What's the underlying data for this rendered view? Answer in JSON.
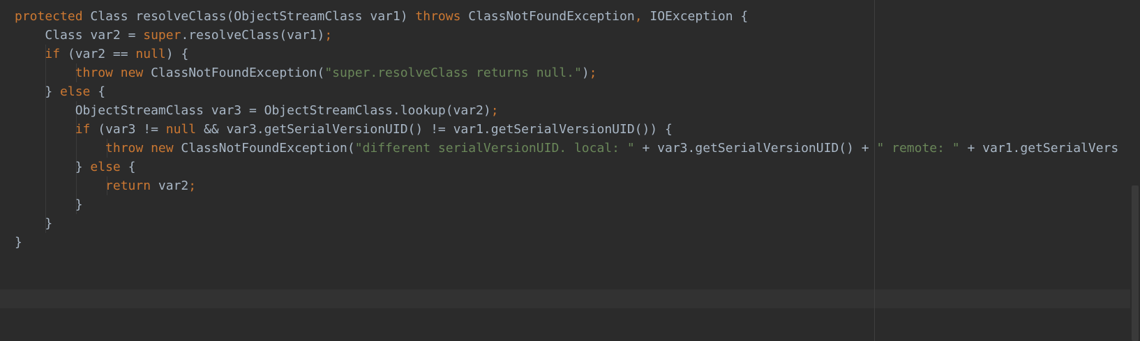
{
  "colors": {
    "background": "#2b2b2b",
    "keyword": "#cc7832",
    "identifier": "#a9b7c6",
    "string": "#6a8759",
    "punctuation": "#cc7832",
    "caret_line": "#323232"
  },
  "code": {
    "lines": [
      {
        "indent": 0,
        "tokens": [
          {
            "t": "kw",
            "v": "protected"
          },
          {
            "t": "ws",
            "v": " "
          },
          {
            "t": "id",
            "v": "Class resolveClass(ObjectStreamClass var1) "
          },
          {
            "t": "kw",
            "v": "throws"
          },
          {
            "t": "ws",
            "v": " "
          },
          {
            "t": "id",
            "v": "ClassNotFoundException"
          },
          {
            "t": "pn",
            "v": ","
          },
          {
            "t": "id",
            "v": " IOException {"
          }
        ]
      },
      {
        "indent": 1,
        "tokens": [
          {
            "t": "id",
            "v": "Class var2 = "
          },
          {
            "t": "kw",
            "v": "super"
          },
          {
            "t": "id",
            "v": ".resolveClass(var1)"
          },
          {
            "t": "pn",
            "v": ";"
          }
        ]
      },
      {
        "indent": 1,
        "tokens": [
          {
            "t": "kw",
            "v": "if"
          },
          {
            "t": "id",
            "v": " (var2 == "
          },
          {
            "t": "kw",
            "v": "null"
          },
          {
            "t": "id",
            "v": ") {"
          }
        ]
      },
      {
        "indent": 2,
        "tokens": [
          {
            "t": "kw",
            "v": "throw"
          },
          {
            "t": "ws",
            "v": " "
          },
          {
            "t": "kw",
            "v": "new"
          },
          {
            "t": "id",
            "v": " ClassNotFoundException("
          },
          {
            "t": "str",
            "v": "\"super.resolveClass returns null.\""
          },
          {
            "t": "id",
            "v": ")"
          },
          {
            "t": "pn",
            "v": ";"
          }
        ]
      },
      {
        "indent": 1,
        "tokens": [
          {
            "t": "id",
            "v": "} "
          },
          {
            "t": "kw",
            "v": "else"
          },
          {
            "t": "id",
            "v": " {"
          }
        ]
      },
      {
        "indent": 2,
        "tokens": [
          {
            "t": "id",
            "v": "ObjectStreamClass var3 = ObjectStreamClass.lookup(var2)"
          },
          {
            "t": "pn",
            "v": ";"
          }
        ]
      },
      {
        "indent": 2,
        "tokens": [
          {
            "t": "kw",
            "v": "if"
          },
          {
            "t": "id",
            "v": " (var3 != "
          },
          {
            "t": "kw",
            "v": "null"
          },
          {
            "t": "id",
            "v": " && var3.getSerialVersionUID() != var1.getSerialVersionUID()) {"
          }
        ]
      },
      {
        "indent": 3,
        "tokens": [
          {
            "t": "kw",
            "v": "throw"
          },
          {
            "t": "ws",
            "v": " "
          },
          {
            "t": "kw",
            "v": "new"
          },
          {
            "t": "id",
            "v": " ClassNotFoundException("
          },
          {
            "t": "str",
            "v": "\"different serialVersionUID. local: \""
          },
          {
            "t": "id",
            "v": " + var3.getSerialVersionUID() + "
          },
          {
            "t": "str",
            "v": "\" remote: \""
          },
          {
            "t": "id",
            "v": " + var1.getSerialVers"
          }
        ]
      },
      {
        "indent": 2,
        "tokens": [
          {
            "t": "id",
            "v": "} "
          },
          {
            "t": "kw",
            "v": "else"
          },
          {
            "t": "id",
            "v": " {"
          }
        ]
      },
      {
        "indent": 3,
        "tokens": [
          {
            "t": "kw",
            "v": "return"
          },
          {
            "t": "id",
            "v": " var2"
          },
          {
            "t": "pn",
            "v": ";"
          }
        ]
      },
      {
        "indent": 2,
        "tokens": [
          {
            "t": "id",
            "v": "}"
          }
        ]
      },
      {
        "indent": 1,
        "tokens": [
          {
            "t": "id",
            "v": "}"
          }
        ]
      },
      {
        "indent": 0,
        "tokens": [
          {
            "t": "id",
            "v": "}"
          }
        ]
      }
    ]
  }
}
